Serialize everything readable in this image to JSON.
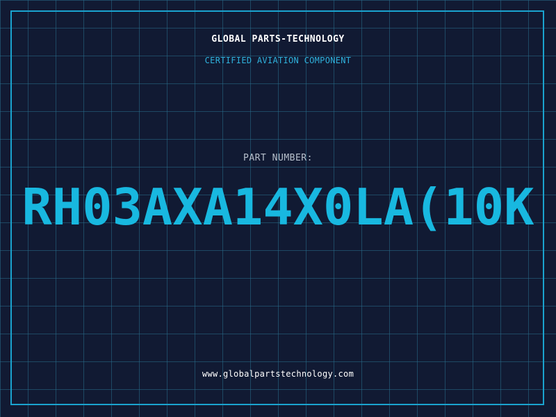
{
  "header": {
    "company_name": "GLOBAL PARTS-TECHNOLOGY",
    "subtitle": "CERTIFIED AVIATION COMPONENT"
  },
  "part": {
    "label": "PART NUMBER:",
    "number": "RH03AXA14X0LA(10K"
  },
  "footer": {
    "url": "www.globalpartstechnology.com"
  },
  "colors": {
    "background": "#111a33",
    "grid": "#286e8c",
    "accent": "#18b8e0",
    "frame": "#1aa3cf"
  }
}
